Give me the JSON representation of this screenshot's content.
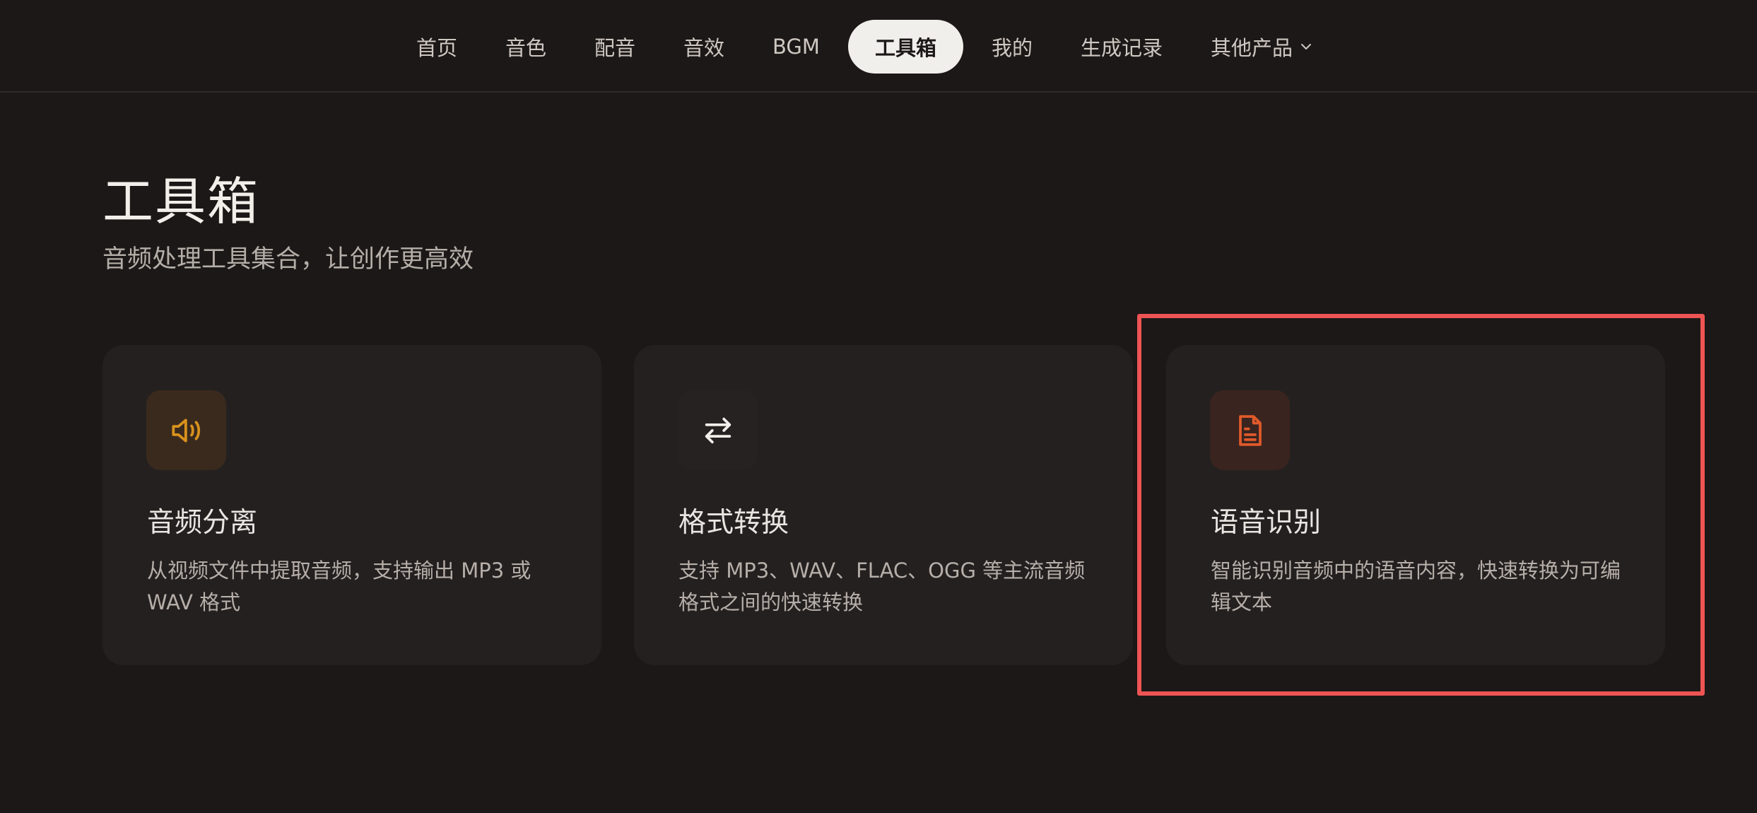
{
  "nav": {
    "items": [
      {
        "label": "首页"
      },
      {
        "label": "音色"
      },
      {
        "label": "配音"
      },
      {
        "label": "音效"
      },
      {
        "label": "BGM"
      },
      {
        "label": "工具箱"
      },
      {
        "label": "我的"
      },
      {
        "label": "生成记录"
      },
      {
        "label": "其他产品"
      }
    ],
    "active": "工具箱"
  },
  "page": {
    "title": "工具箱",
    "subtitle": "音频处理工具集合，让创作更高效"
  },
  "cards": [
    {
      "title": "音频分离",
      "description": "从视频文件中提取音频，支持输出 MP3 或 WAV 格式",
      "icon": "speaker-icon",
      "icon_color": "#d9921d",
      "icon_bg": "#3a2a1d"
    },
    {
      "title": "格式转换",
      "description": "支持 MP3、WAV、FLAC、OGG 等主流音频格式之间的快速转换",
      "icon": "swap-arrows-icon",
      "icon_color": "#f2efeb",
      "icon_bg": "#262221"
    },
    {
      "title": "语音识别",
      "description": "智能识别音频中的语音内容，快速转换为可编辑文本",
      "icon": "document-icon",
      "icon_color": "#e05a2a",
      "icon_bg": "#3a2420"
    }
  ],
  "colors": {
    "background": "#1c1817",
    "card": "#242020",
    "highlight": "#ef5454"
  }
}
